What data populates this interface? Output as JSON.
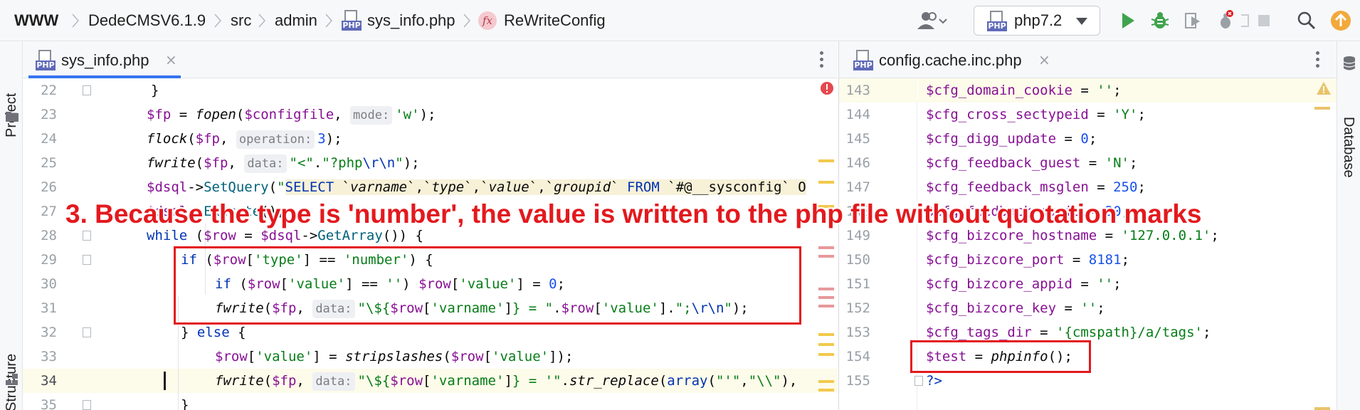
{
  "breadcrumb": {
    "items": [
      "WWW",
      "DedeCMSV6.1.9",
      "src",
      "admin",
      "sys_info.php",
      "ReWriteConfig"
    ],
    "file_badge": "PHP",
    "function_badge": "fx"
  },
  "toolbar": {
    "run_config": "php7.2",
    "run_config_badge": "PHP",
    "icons": [
      "user-icon",
      "run-icon",
      "debug-icon",
      "coverage-icon",
      "profile-icon",
      "stop-icon",
      "search-icon",
      "update-icon"
    ]
  },
  "side_panels": {
    "left_top": "Project",
    "left_bottom": "Structure",
    "right": "Database"
  },
  "left_editor": {
    "tab": {
      "label": "sys_info.php",
      "badge": "PHP"
    },
    "line_numbers": [
      "22",
      "23",
      "24",
      "25",
      "26",
      "27",
      "28",
      "29",
      "30",
      "31",
      "32",
      "33",
      "34",
      "35"
    ]
  },
  "right_editor": {
    "tab": {
      "label": "config.cache.inc.php",
      "badge": "PHP"
    },
    "line_numbers": [
      "143",
      "144",
      "145",
      "146",
      "147",
      "148",
      "149",
      "150",
      "151",
      "152",
      "153",
      "154",
      "155"
    ]
  },
  "hints": {
    "mode": "mode:",
    "operation": "operation:",
    "data": "data:"
  },
  "annotation": "3. Because the type is 'number', the value is written to the php file without quotation marks",
  "colors": {
    "annotation": "#e3191e",
    "accent": "#3574f0",
    "keyword": "#0033b3",
    "variable": "#871094",
    "string": "#067d17",
    "number": "#1750eb"
  }
}
